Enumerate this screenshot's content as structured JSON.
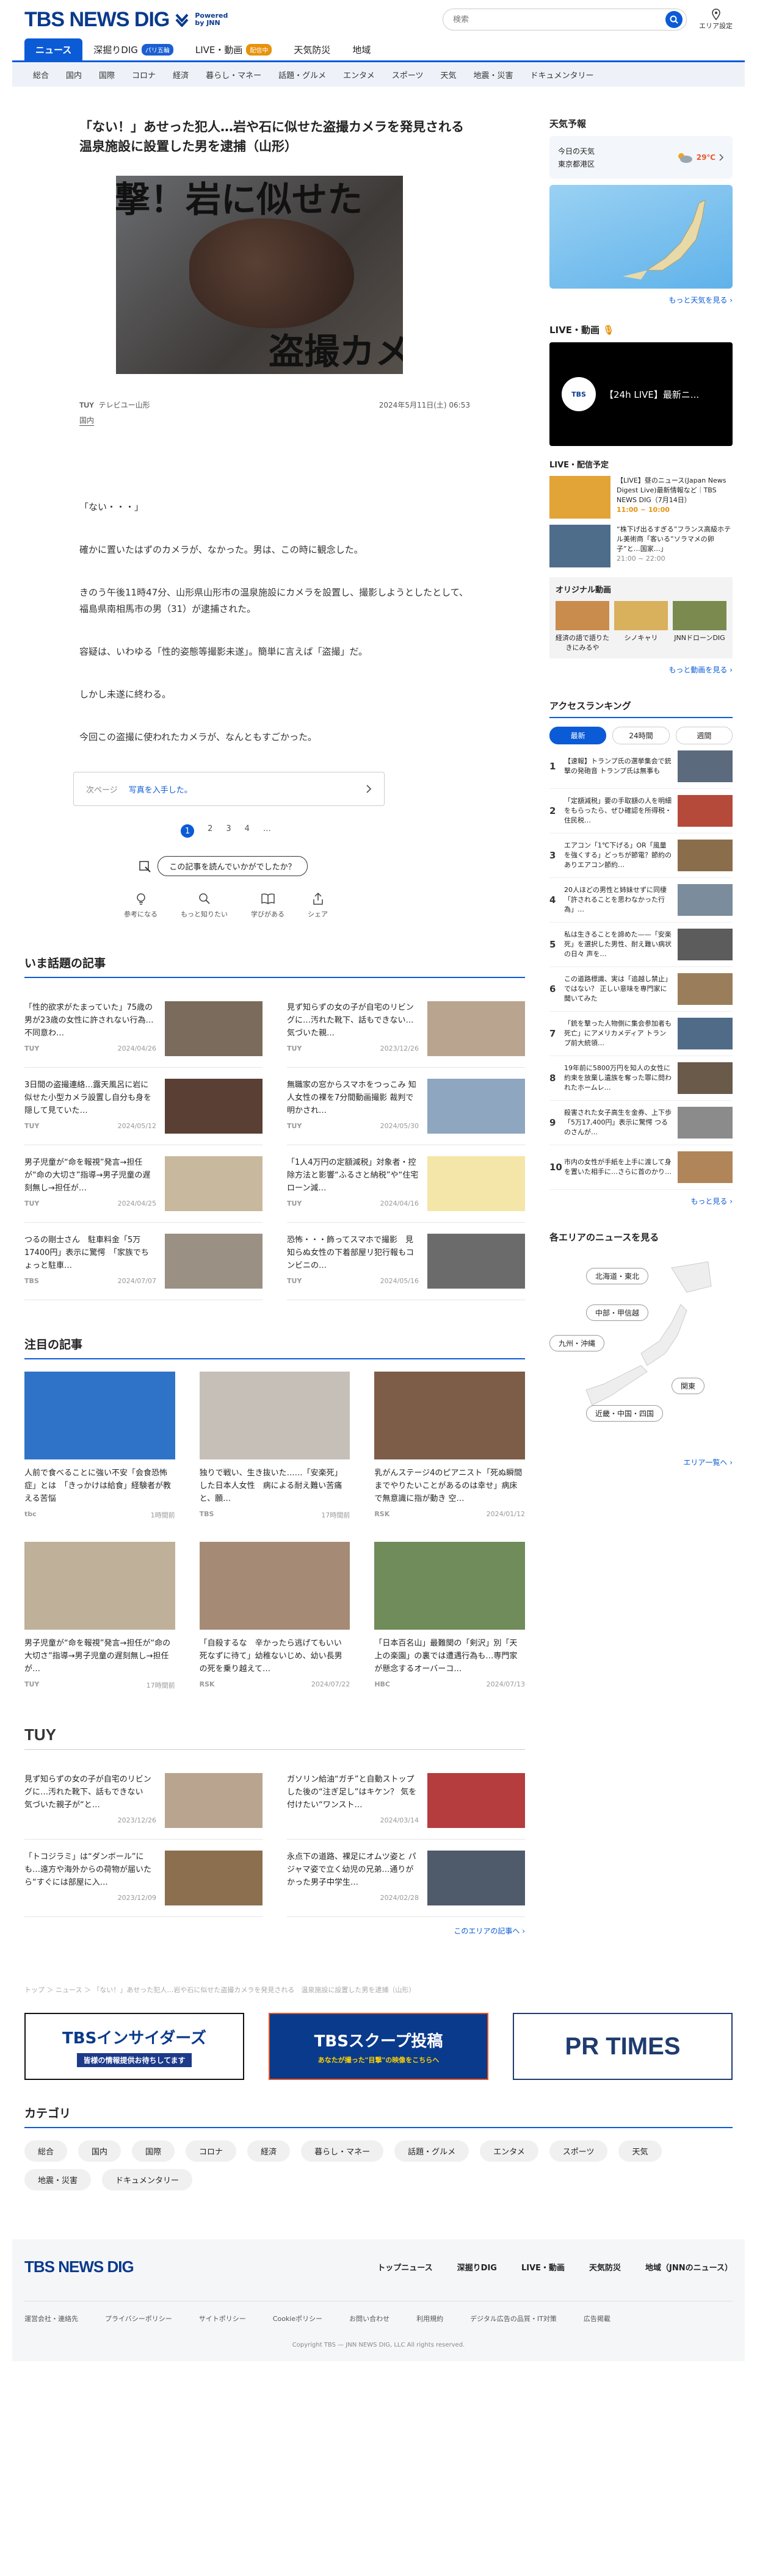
{
  "header": {
    "logo": "TBS NEWS DIG",
    "powered": "Powered by JNN",
    "search_placeholder": "検索",
    "location_label": "エリア設定"
  },
  "nav_main": [
    {
      "label": "ニュース",
      "active": true
    },
    {
      "label": "深掘りDIG",
      "badge": "パリ五輪",
      "badge_color": "#1b5fd3"
    },
    {
      "label": "LIVE・動画",
      "badge": "配信中",
      "badge_color": "#e8920c"
    },
    {
      "label": "天気防災"
    },
    {
      "label": "地域"
    }
  ],
  "nav_sub": [
    "総合",
    "国内",
    "国際",
    "コロナ",
    "経済",
    "暮らし・マネー",
    "話題・グルメ",
    "エンタメ",
    "スポーツ",
    "天気",
    "地震・災害",
    "ドキュメンタリー"
  ],
  "article": {
    "title": "「ない！」あせった犯人…岩や石に似せた盗撮カメラを発見される　温泉施設に設置した男を逮捕（山形）",
    "hero_text_top": "衝撃！岩に似せた",
    "hero_text_bottom": "盗撮カメラ",
    "source": "テレビユー山形",
    "datetime": "2024年5月11日(土) 06:53",
    "category": "国内",
    "paragraphs": [
      "「ない・・・」",
      "確かに置いたはずのカメラが、なかった。男は、この時に観念した。",
      "きのう午後11時47分、山形県山形市の温泉施設にカメラを設置し、撮影しようとしたとして、福島県南相馬市の男（31）が逮捕された。",
      "容疑は、いわゆる「性的姿態等撮影未遂」。簡単に言えば「盗撮」だ。",
      "しかし未遂に終わる。",
      "今回この盗撮に使われたカメラが、なんともすごかった。"
    ],
    "next_label": "次ページ",
    "next_text": "写真を入手した。",
    "pages": [
      "1",
      "2",
      "3",
      "4",
      "…"
    ],
    "question": "この記事を読んでいかがでしたか？",
    "reactions": [
      "参考になる",
      "もっと知りたい",
      "学びがある",
      "シェア"
    ]
  },
  "topics": {
    "title": "いま話題の記事",
    "items": [
      {
        "text": "「性的欲求がたまっていた」75歳の男が23歳の女性に許されない行為…不同意わ…",
        "source": "TUY",
        "date": "2024/04/26",
        "thumb": "#7a6b5c"
      },
      {
        "text": "見ず知らずの女の子が自宅のリビングに…汚れた靴下、話もできない…　気づいた親…",
        "source": "TUY",
        "date": "2023/12/26",
        "thumb": "#b9a48f"
      },
      {
        "text": "3日間の盗撮連絡…露天風呂に岩に似せた小型カメラ設置し自分も身を隠して見ていた…",
        "source": "TUY",
        "date": "2024/05/12",
        "thumb": "#5a4034"
      },
      {
        "text": "無職家の窓からスマホをつっこみ 知人女性の裸を7分間動画撮影 裁判で明かされ…",
        "source": "TUY",
        "date": "2024/05/30",
        "thumb": "#8ea6bf"
      },
      {
        "text": "男子児童が“命を報視”発言→担任が“命の大切さ”指導→男子児童の遅刻無し→担任が…",
        "source": "TUY",
        "date": "2024/04/25",
        "thumb": "#c8b89e"
      },
      {
        "text": "「1人4万円の定額減税」対象者・控除方法と影響“ふるさと納税”や“住宅ローン減…",
        "source": "TUY",
        "date": "2024/04/16",
        "thumb": "#f4e6a8"
      },
      {
        "text": "つるの剛士さん　駐車料金「5万17400円」表示に驚愕　「家族でちょっと駐車…",
        "source": "TBS",
        "date": "2024/07/07",
        "thumb": "#9a9083"
      },
      {
        "text": "恐怖・・・飾ってスマホで撮影　見知らぬ女性の下着部屋リ犯行報もコンビニの…",
        "source": "TUY",
        "date": "2024/05/16",
        "thumb": "#6b6b6b"
      }
    ]
  },
  "featured": {
    "title": "注目の記事",
    "items": [
      {
        "text": "人前で食べることに強い不安「会食恐怖症」とは　「きっかけは給食」経験者が教える苦悩",
        "source": "tbc",
        "date": "1時間前",
        "thumb": "#2f73c9"
      },
      {
        "text": "独りで戦い、生き抜いた……「安楽死」した日本人女性　病による耐え難い苦痛と、願…",
        "source": "TBS",
        "date": "17時間前",
        "thumb": "#c5bfb8"
      },
      {
        "text": "乳がんステージ4のピアニスト「死ぬ瞬間までやりたいことがあるのは幸せ」病床で無意識に指が動き 空…",
        "source": "RSK",
        "date": "2024/01/12",
        "thumb": "#7d5c48"
      },
      {
        "text": "男子児童が“命を報視”発言→担任が“命の大切さ”指導→男子児童の遅刻無し→担任が…",
        "source": "TUY",
        "date": "17時間前",
        "thumb": "#bfb09a"
      },
      {
        "text": "「自殺するな　辛かったら逃げてもいい　死なずに待て」幼稚ないじめ、幼い長男の死を乗り越えて…",
        "source": "RSK",
        "date": "2024/07/22",
        "thumb": "#a58b76"
      },
      {
        "text": "「日本百名山」最難関の「剣沢」別「天上の楽園」の裏では遭遇行為も…専門家が懸念するオーバーコ…",
        "source": "HBC",
        "date": "2024/07/13",
        "thumb": "#6f8c5a"
      }
    ]
  },
  "local": {
    "logo": "TUY",
    "items": [
      {
        "text": "見ず知らずの女の子が自宅のリビングに…汚れた靴下、話もできない　気づいた親子が“と…",
        "date": "2023/12/26",
        "thumb": "#b9a48f"
      },
      {
        "text": "ガソリン給油“ガチ”と自動ストップした後の“注ぎ足し”はキケン？ 気を付けたい“ワンスト…",
        "date": "2024/03/14",
        "thumb": "#b53d3d"
      },
      {
        "text": "「トコジラミ」は“ダンボール”にも…遠方や海外からの荷物が届いたら“すぐには部屋に入…",
        "date": "2023/12/09",
        "thumb": "#8b6f4e"
      },
      {
        "text": "永点下の道路、裸足にオムツ姿と パジャマ姿で立く幼児の兄弟…通りがかった男子中学生…",
        "date": "2024/02/28",
        "thumb": "#4f5b6b"
      }
    ],
    "more": "このエリアの記事へ ›"
  },
  "breadcrumb": "トップ ＞ ニュース ＞ 「ない！」あせった犯人…岩や石に似せた盗撮カメラを発見される　温泉施設に設置した男を逮捕（山形）",
  "ads": [
    "TBSインサイダーズ",
    "TBSスクープ投稿",
    "PR TIMES"
  ],
  "ads_sub": [
    "皆様の情報提供お待ちしてます",
    "あなたが撮った\"目撃\"の映像をこちらへ"
  ],
  "categories": {
    "title": "カテゴリ",
    "items": [
      "総合",
      "国内",
      "国際",
      "コロナ",
      "経済",
      "暮らし・マネー",
      "話題・グルメ",
      "エンタメ",
      "スポーツ",
      "天気",
      "地震・災害",
      "ドキュメンタリー"
    ]
  },
  "sidebar": {
    "weather_title": "天気予報",
    "weather_label": "今日の天気",
    "weather_city": "東京都港区",
    "weather_temp": "29℃",
    "weather_more": "もっと天気を見る ›",
    "live_title": "LIVE・動画",
    "live_title_suffix": "🎙",
    "live_video": "【24h LIVE】最新ニ...",
    "live_sched_title": "LIVE・配信予定",
    "live_items": [
      {
        "text": "【LIVE】昼のニュース(Japan News Digest Live)最新情報など｜TBS NEWS DIG（7月14日）",
        "time": "11:00 ~ 10:00"
      },
      {
        "text": "“株下げ出るすぎる”フランス高級ホテル美術商「客いる”ソラマメの卵子”と…国家…」",
        "time": "21:00 ~ 22:00"
      }
    ],
    "orig_title": "オリジナル動画",
    "orig_items": [
      "経済の語で語りたきにみるや",
      "シノキャリ",
      "JNNドローンDIG"
    ],
    "orig_more": "もっと動画を見る ›",
    "rank_title": "アクセスランキング",
    "rank_tabs": [
      "最新",
      "24時間",
      "週間"
    ],
    "ranking": [
      {
        "n": "1",
        "text": "【速報】トランプ氏の選挙集会で銃撃の発砲音 トランプ氏は無事も"
      },
      {
        "n": "2",
        "text": "「定額減税」要の手取額の人を明細をもらったら、ぜひ確認を所得税・住民税…"
      },
      {
        "n": "3",
        "text": "エアコン「1℃下げる」OR「風量を強くする」どっちが節電？節約のありエアコン節約…"
      },
      {
        "n": "4",
        "text": "20人ほどの男性と姉妹せずに同棲「許されることを思わなかった行為」…"
      },
      {
        "n": "5",
        "text": "私は生きることを諦めた——「安楽死」を選択した男性、耐え難い病状の日々 声を…"
      },
      {
        "n": "6",
        "text": "この道路標識、実は「追越し禁止」ではない？ 正しい意味を専門家に聞いてみた"
      },
      {
        "n": "7",
        "text": "「銃を撃った人物側に集会参加者も死亡」にアメリカメディア トランプ前大統領…"
      },
      {
        "n": "8",
        "text": "19年前に5800万円を知人の女性に約束を放棄し遺族を奪った罪に問われたホームレ…"
      },
      {
        "n": "9",
        "text": "殺害された女子高生を金券、上下歩「5万17,400円」表示に驚愕 つるのさんが…"
      },
      {
        "n": "10",
        "text": "市内の女性が手紙を上手に渡して身を置いた相手に…さらに首のかり…"
      }
    ],
    "rank_more": "もっと見る ›",
    "area_title": "各エリアのニュースを見る",
    "areas": [
      "北海道・東北",
      "中部・甲信越",
      "九州・沖縄",
      "関東",
      "近畿・中国・四国"
    ],
    "area_more": "エリア一覧へ ›"
  },
  "footer": {
    "logo": "TBS NEWS DIG",
    "nav": [
      "トップニュース",
      "深掘りDIG",
      "LIVE・動画",
      "天気防災",
      "地域（JNNのニュース）"
    ],
    "links": [
      "運営会社・連絡先",
      "プライバシーポリシー",
      "サイトポリシー",
      "Cookieポリシー",
      "お問い合わせ",
      "利用規約",
      "デジタル広告の品質・IT対策",
      "広告掲載"
    ],
    "copyright": "Copyright TBS — JNN NEWS DIG, LLC All rights reserved."
  }
}
